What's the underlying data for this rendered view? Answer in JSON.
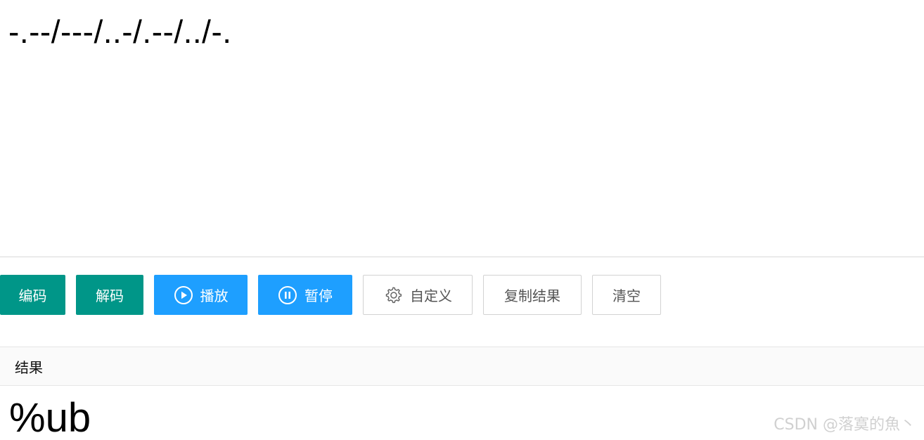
{
  "input": {
    "value": "-.--/---/..-/.--/../-."
  },
  "toolbar": {
    "encode_label": "编码",
    "decode_label": "解码",
    "play_label": "播放",
    "pause_label": "暂停",
    "custom_label": "自定义",
    "copy_label": "复制结果",
    "clear_label": "清空"
  },
  "result": {
    "header": "结果",
    "value": "%ub"
  },
  "watermark": "CSDN @落寞的魚丶",
  "colors": {
    "teal": "#009688",
    "blue": "#1e9fff",
    "border": "#d2d2d2"
  },
  "icons": {
    "play": "play-circle-icon",
    "pause": "pause-circle-icon",
    "custom": "gear-icon"
  }
}
